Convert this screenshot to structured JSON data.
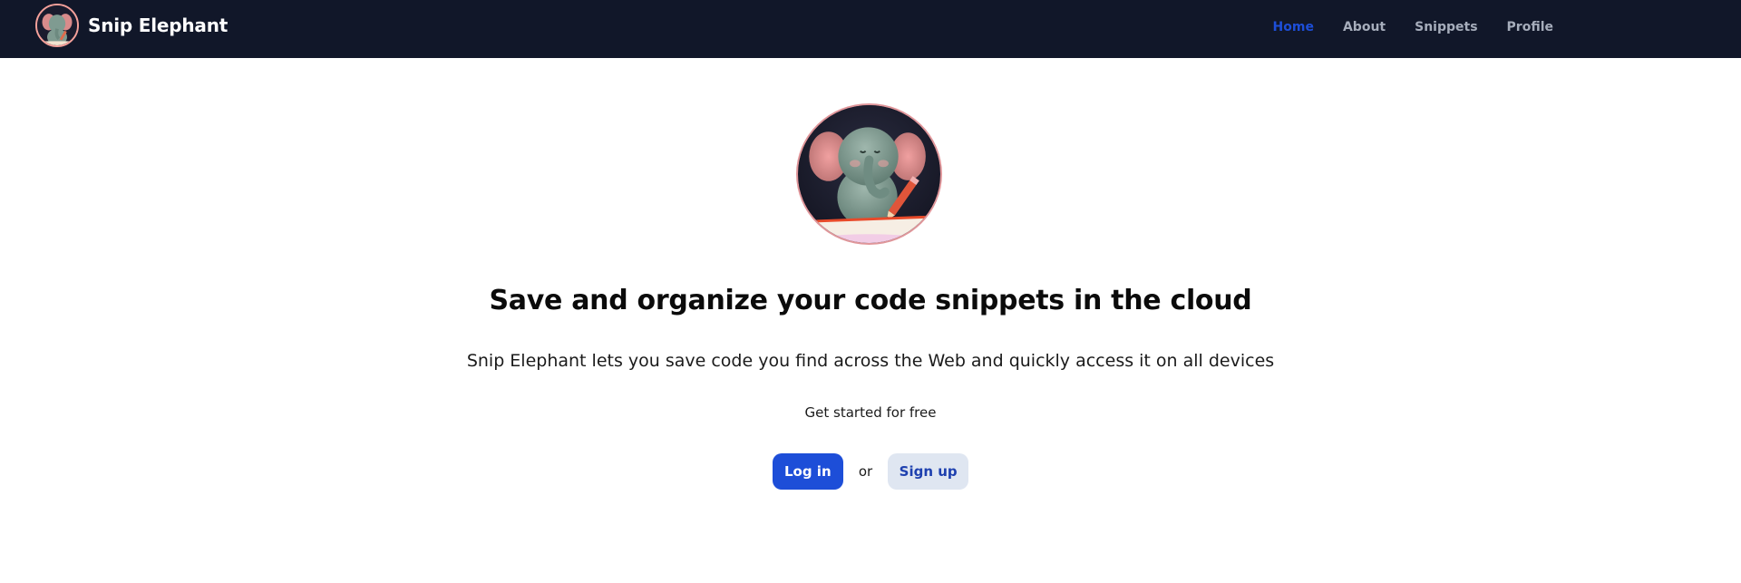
{
  "brand": {
    "name": "Snip Elephant",
    "logo_icon": "elephant-logo-icon"
  },
  "nav": {
    "items": [
      {
        "label": "Home",
        "active": true
      },
      {
        "label": "About",
        "active": false
      },
      {
        "label": "Snippets",
        "active": false
      },
      {
        "label": "Profile",
        "active": false
      }
    ]
  },
  "hero": {
    "image_icon": "elephant-writing-icon",
    "headline": "Save and organize your code snippets in the cloud",
    "subline": "Snip Elephant lets you save code you find across the Web and quickly access it on all devices",
    "cta_text": "Get started for free",
    "login_label": "Log in",
    "or_label": "or",
    "signup_label": "Sign up"
  },
  "colors": {
    "navbar_bg": "#111729",
    "nav_active": "#1d4ed8",
    "nav_inactive": "#a6adbb",
    "primary_button": "#1d4ed8",
    "secondary_button": "#dfe6f1",
    "secondary_button_text": "#1e40af"
  }
}
